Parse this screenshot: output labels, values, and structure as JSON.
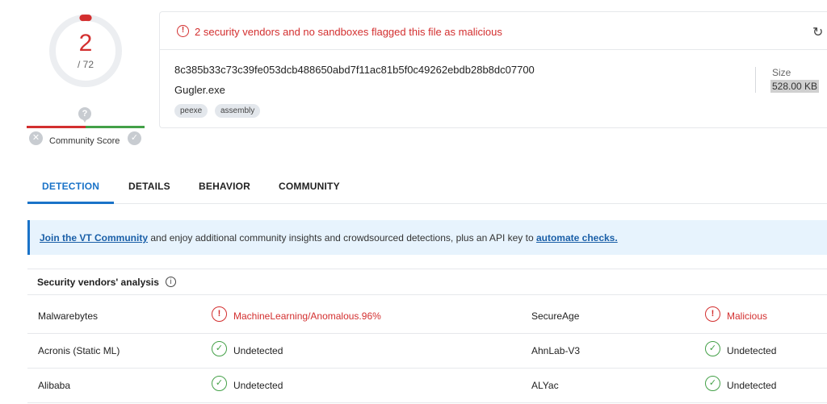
{
  "score": {
    "detections": "2",
    "total": "/ 72",
    "fraction": 0.028
  },
  "community": {
    "label": "Community Score",
    "question": "?",
    "down": "✕",
    "up": "✓"
  },
  "alert": {
    "icon": "!",
    "text": "2 security vendors and no sandboxes flagged this file as malicious",
    "refresh_icon": "↻"
  },
  "file": {
    "hash": "8c385b33c73c39fe053dcb488650abd7f11ac81b5f0c49262ebdb28b8dc07700",
    "name": "Gugler.exe",
    "tags": [
      "peexe",
      "assembly"
    ],
    "size_label": "Size",
    "size_value": "528.00 KB"
  },
  "tabs": [
    "DETECTION",
    "DETAILS",
    "BEHAVIOR",
    "COMMUNITY"
  ],
  "banner": {
    "link1": "Join the VT Community",
    "middle": " and enjoy additional community insights and crowdsourced detections, plus an API key to ",
    "link2": "automate checks."
  },
  "vendors": {
    "title": "Security vendors' analysis",
    "info_icon": "i",
    "rows": [
      {
        "left_name": "Malwarebytes",
        "left_result": "MachineLearning/Anomalous.96%",
        "left_status": "bad",
        "right_name": "SecureAge",
        "right_result": "Malicious",
        "right_status": "bad"
      },
      {
        "left_name": "Acronis (Static ML)",
        "left_result": "Undetected",
        "left_status": "ok",
        "right_name": "AhnLab-V3",
        "right_result": "Undetected",
        "right_status": "ok"
      },
      {
        "left_name": "Alibaba",
        "left_result": "Undetected",
        "left_status": "ok",
        "right_name": "ALYac",
        "right_result": "Undetected",
        "right_status": "ok"
      }
    ]
  },
  "colors": {
    "malicious": "#d32f2f",
    "clean": "#43a047",
    "accent": "#1a73c8"
  }
}
